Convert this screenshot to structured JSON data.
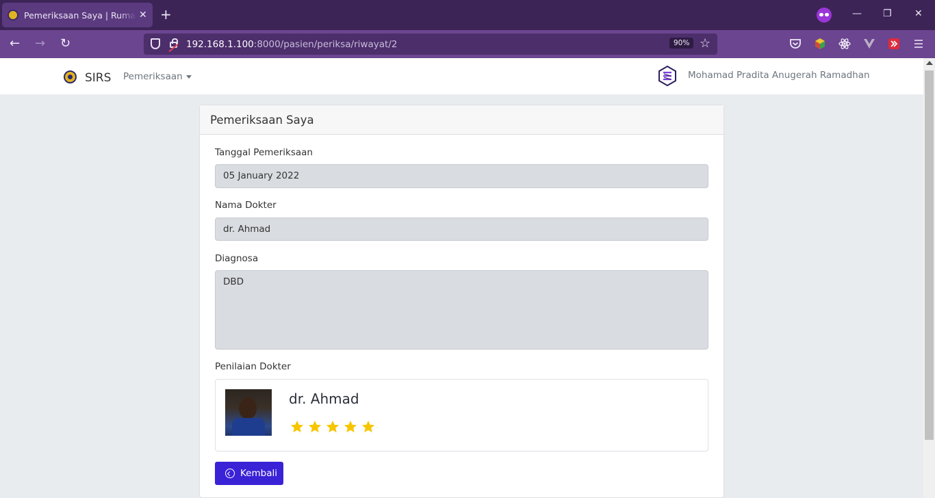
{
  "browser": {
    "tab_title": "Pemeriksaan Saya | Rumah Sakit",
    "url_host": "192.168.1.100",
    "url_rest": ":8000/pasien/periksa/riwayat/2",
    "zoom": "90%"
  },
  "nav": {
    "brand": "SIRS",
    "menu_label": "Pemeriksaan",
    "user_name": "Mohamad Pradita Anugerah Ramadhan"
  },
  "card": {
    "title": "Pemeriksaan Saya",
    "fields": {
      "date_label": "Tanggal Pemeriksaan",
      "date_value": "05 January 2022",
      "doctor_label": "Nama Dokter",
      "doctor_value": "dr. Ahmad",
      "diagnosis_label": "Diagnosa",
      "diagnosis_value": "DBD"
    },
    "rating": {
      "label": "Penilaian Dokter",
      "doctor_name": "dr. Ahmad",
      "stars": 5,
      "star_color": "#f7c600"
    },
    "back_button": "Kembali"
  },
  "colors": {
    "primary_button": "#3a22d6",
    "browser_accent": "#6b4590"
  }
}
